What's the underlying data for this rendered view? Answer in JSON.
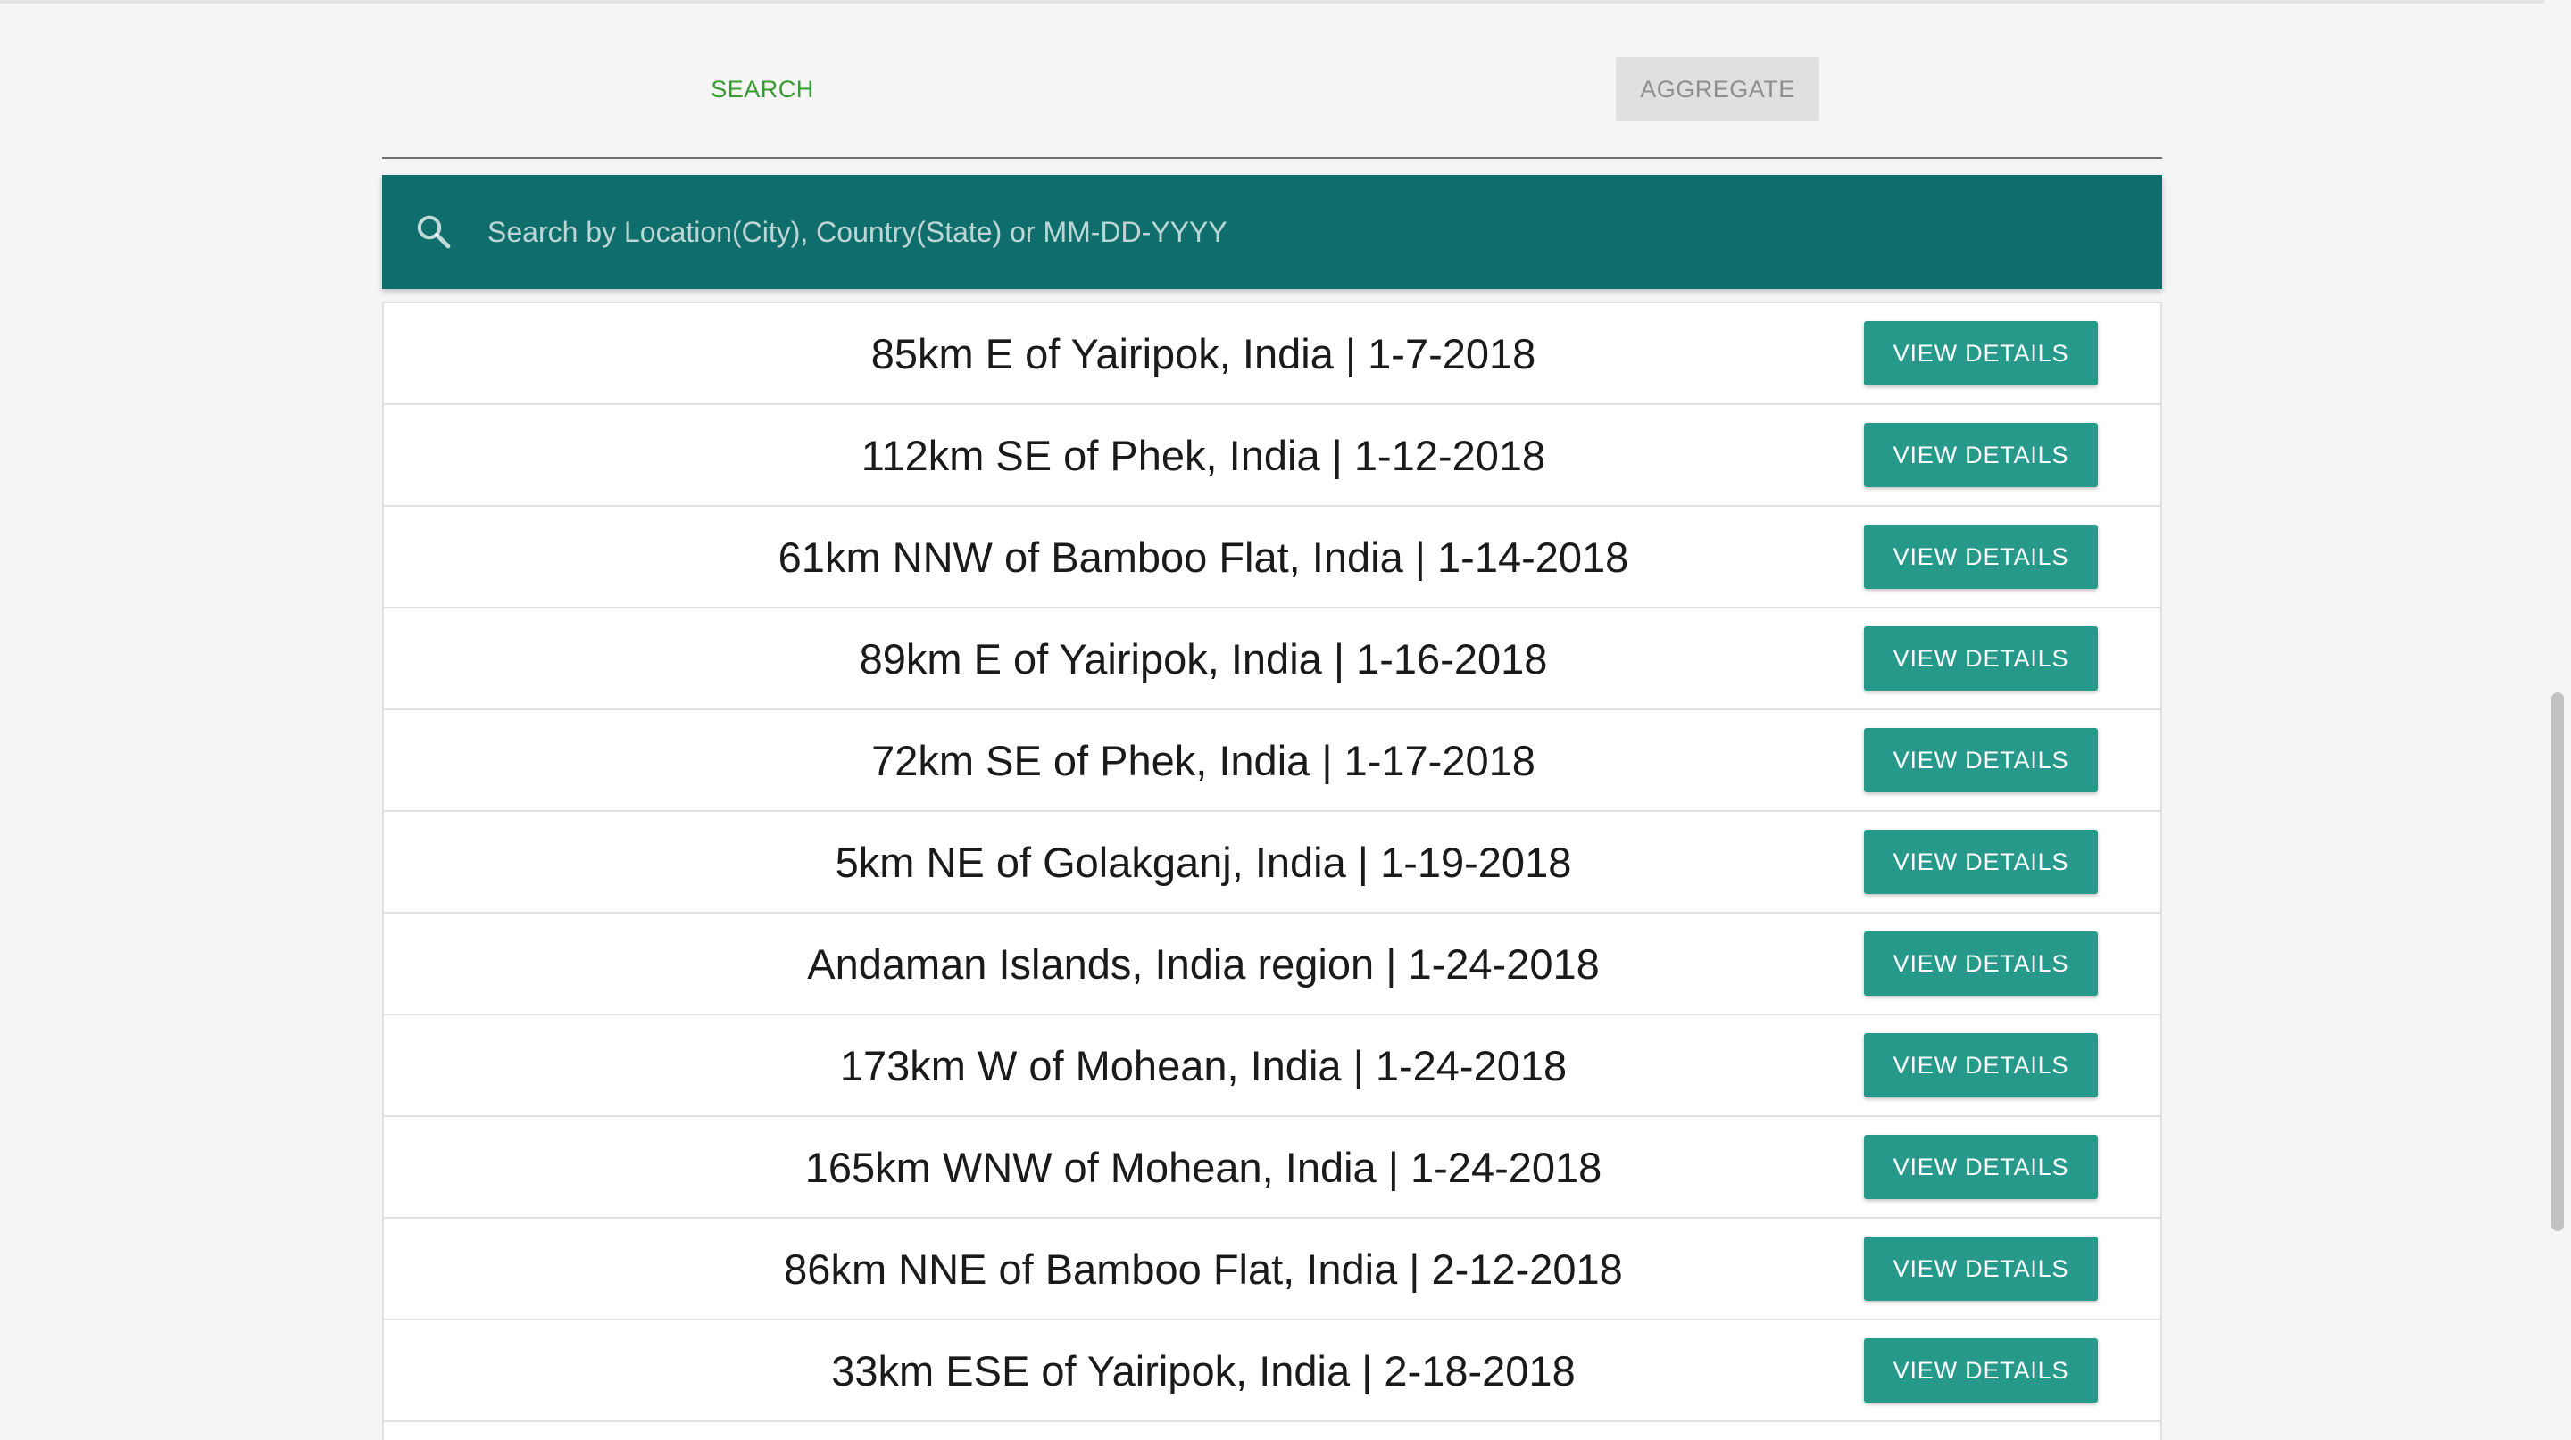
{
  "tabs": {
    "search_label": "SEARCH",
    "aggregate_label": "AGGREGATE"
  },
  "search": {
    "placeholder": "Search by Location(City), Country(State) or MM-DD-YYYY",
    "value": "",
    "icon": "search-icon"
  },
  "colors": {
    "search_bar": "#0f6e6c",
    "button": "#26998b",
    "tab_active": "#3a9a34"
  },
  "results": [
    {
      "label": "85km E of Yairipok, India | 1-7-2018",
      "button": "VIEW DETAILS"
    },
    {
      "label": "112km SE of Phek, India | 1-12-2018",
      "button": "VIEW DETAILS"
    },
    {
      "label": "61km NNW of Bamboo Flat, India | 1-14-2018",
      "button": "VIEW DETAILS"
    },
    {
      "label": "89km E of Yairipok, India | 1-16-2018",
      "button": "VIEW DETAILS"
    },
    {
      "label": "72km SE of Phek, India | 1-17-2018",
      "button": "VIEW DETAILS"
    },
    {
      "label": "5km NE of Golakganj, India | 1-19-2018",
      "button": "VIEW DETAILS"
    },
    {
      "label": "Andaman Islands, India region | 1-24-2018",
      "button": "VIEW DETAILS"
    },
    {
      "label": "173km W of Mohean, India | 1-24-2018",
      "button": "VIEW DETAILS"
    },
    {
      "label": "165km WNW of Mohean, India | 1-24-2018",
      "button": "VIEW DETAILS"
    },
    {
      "label": "86km NNE of Bamboo Flat, India | 2-12-2018",
      "button": "VIEW DETAILS"
    },
    {
      "label": "33km ESE of Yairipok, India | 2-18-2018",
      "button": "VIEW DETAILS"
    }
  ]
}
